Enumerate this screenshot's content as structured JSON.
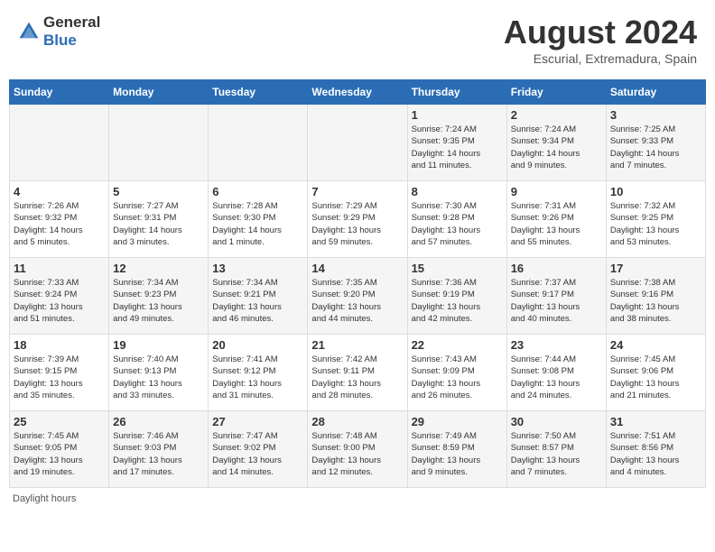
{
  "header": {
    "logo_general": "General",
    "logo_blue": "Blue",
    "month_year": "August 2024",
    "location": "Escurial, Extremadura, Spain"
  },
  "days_of_week": [
    "Sunday",
    "Monday",
    "Tuesday",
    "Wednesday",
    "Thursday",
    "Friday",
    "Saturday"
  ],
  "weeks": [
    [
      {
        "day": "",
        "info": ""
      },
      {
        "day": "",
        "info": ""
      },
      {
        "day": "",
        "info": ""
      },
      {
        "day": "",
        "info": ""
      },
      {
        "day": "1",
        "info": "Sunrise: 7:24 AM\nSunset: 9:35 PM\nDaylight: 14 hours\nand 11 minutes."
      },
      {
        "day": "2",
        "info": "Sunrise: 7:24 AM\nSunset: 9:34 PM\nDaylight: 14 hours\nand 9 minutes."
      },
      {
        "day": "3",
        "info": "Sunrise: 7:25 AM\nSunset: 9:33 PM\nDaylight: 14 hours\nand 7 minutes."
      }
    ],
    [
      {
        "day": "4",
        "info": "Sunrise: 7:26 AM\nSunset: 9:32 PM\nDaylight: 14 hours\nand 5 minutes."
      },
      {
        "day": "5",
        "info": "Sunrise: 7:27 AM\nSunset: 9:31 PM\nDaylight: 14 hours\nand 3 minutes."
      },
      {
        "day": "6",
        "info": "Sunrise: 7:28 AM\nSunset: 9:30 PM\nDaylight: 14 hours\nand 1 minute."
      },
      {
        "day": "7",
        "info": "Sunrise: 7:29 AM\nSunset: 9:29 PM\nDaylight: 13 hours\nand 59 minutes."
      },
      {
        "day": "8",
        "info": "Sunrise: 7:30 AM\nSunset: 9:28 PM\nDaylight: 13 hours\nand 57 minutes."
      },
      {
        "day": "9",
        "info": "Sunrise: 7:31 AM\nSunset: 9:26 PM\nDaylight: 13 hours\nand 55 minutes."
      },
      {
        "day": "10",
        "info": "Sunrise: 7:32 AM\nSunset: 9:25 PM\nDaylight: 13 hours\nand 53 minutes."
      }
    ],
    [
      {
        "day": "11",
        "info": "Sunrise: 7:33 AM\nSunset: 9:24 PM\nDaylight: 13 hours\nand 51 minutes."
      },
      {
        "day": "12",
        "info": "Sunrise: 7:34 AM\nSunset: 9:23 PM\nDaylight: 13 hours\nand 49 minutes."
      },
      {
        "day": "13",
        "info": "Sunrise: 7:34 AM\nSunset: 9:21 PM\nDaylight: 13 hours\nand 46 minutes."
      },
      {
        "day": "14",
        "info": "Sunrise: 7:35 AM\nSunset: 9:20 PM\nDaylight: 13 hours\nand 44 minutes."
      },
      {
        "day": "15",
        "info": "Sunrise: 7:36 AM\nSunset: 9:19 PM\nDaylight: 13 hours\nand 42 minutes."
      },
      {
        "day": "16",
        "info": "Sunrise: 7:37 AM\nSunset: 9:17 PM\nDaylight: 13 hours\nand 40 minutes."
      },
      {
        "day": "17",
        "info": "Sunrise: 7:38 AM\nSunset: 9:16 PM\nDaylight: 13 hours\nand 38 minutes."
      }
    ],
    [
      {
        "day": "18",
        "info": "Sunrise: 7:39 AM\nSunset: 9:15 PM\nDaylight: 13 hours\nand 35 minutes."
      },
      {
        "day": "19",
        "info": "Sunrise: 7:40 AM\nSunset: 9:13 PM\nDaylight: 13 hours\nand 33 minutes."
      },
      {
        "day": "20",
        "info": "Sunrise: 7:41 AM\nSunset: 9:12 PM\nDaylight: 13 hours\nand 31 minutes."
      },
      {
        "day": "21",
        "info": "Sunrise: 7:42 AM\nSunset: 9:11 PM\nDaylight: 13 hours\nand 28 minutes."
      },
      {
        "day": "22",
        "info": "Sunrise: 7:43 AM\nSunset: 9:09 PM\nDaylight: 13 hours\nand 26 minutes."
      },
      {
        "day": "23",
        "info": "Sunrise: 7:44 AM\nSunset: 9:08 PM\nDaylight: 13 hours\nand 24 minutes."
      },
      {
        "day": "24",
        "info": "Sunrise: 7:45 AM\nSunset: 9:06 PM\nDaylight: 13 hours\nand 21 minutes."
      }
    ],
    [
      {
        "day": "25",
        "info": "Sunrise: 7:45 AM\nSunset: 9:05 PM\nDaylight: 13 hours\nand 19 minutes."
      },
      {
        "day": "26",
        "info": "Sunrise: 7:46 AM\nSunset: 9:03 PM\nDaylight: 13 hours\nand 17 minutes."
      },
      {
        "day": "27",
        "info": "Sunrise: 7:47 AM\nSunset: 9:02 PM\nDaylight: 13 hours\nand 14 minutes."
      },
      {
        "day": "28",
        "info": "Sunrise: 7:48 AM\nSunset: 9:00 PM\nDaylight: 13 hours\nand 12 minutes."
      },
      {
        "day": "29",
        "info": "Sunrise: 7:49 AM\nSunset: 8:59 PM\nDaylight: 13 hours\nand 9 minutes."
      },
      {
        "day": "30",
        "info": "Sunrise: 7:50 AM\nSunset: 8:57 PM\nDaylight: 13 hours\nand 7 minutes."
      },
      {
        "day": "31",
        "info": "Sunrise: 7:51 AM\nSunset: 8:56 PM\nDaylight: 13 hours\nand 4 minutes."
      }
    ]
  ],
  "footer": {
    "note": "Daylight hours"
  }
}
